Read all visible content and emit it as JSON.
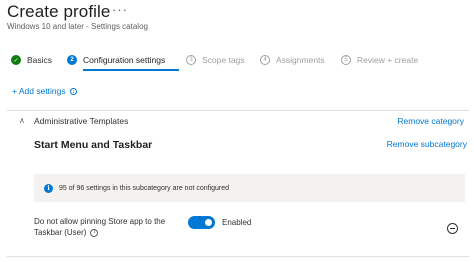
{
  "header": {
    "title": "Create profile",
    "more": "···",
    "subtitle": "Windows 10 and later - Settings catalog"
  },
  "wizard": {
    "steps": [
      {
        "number": "✓",
        "label": "Basics",
        "state": "done"
      },
      {
        "number": "2",
        "label": "Configuration settings",
        "state": "current"
      },
      {
        "number": "3",
        "label": "Scope tags",
        "state": "future"
      },
      {
        "number": "4",
        "label": "Assignments",
        "state": "future"
      },
      {
        "number": "5",
        "label": "Review + create",
        "state": "future"
      }
    ]
  },
  "add_settings_label": "+ Add settings",
  "add_settings_icon": "info-circle-icon",
  "category": {
    "name": "Administrative Templates",
    "remove_label": "Remove category",
    "chevron": "∧"
  },
  "subcategory": {
    "title": "Start Menu and Taskbar",
    "remove_label": "Remove subcategory",
    "info_text": "95 of 96 settings in this subcategory are not configured",
    "info_icon_glyph": "i"
  },
  "setting": {
    "name": "Do not allow pinning Store app to the Taskbar (User)",
    "info_icon_glyph": "i",
    "toggle_on": true,
    "toggle_label": "Enabled"
  },
  "colors": {
    "accent": "#0078d4",
    "success": "#107c10"
  }
}
